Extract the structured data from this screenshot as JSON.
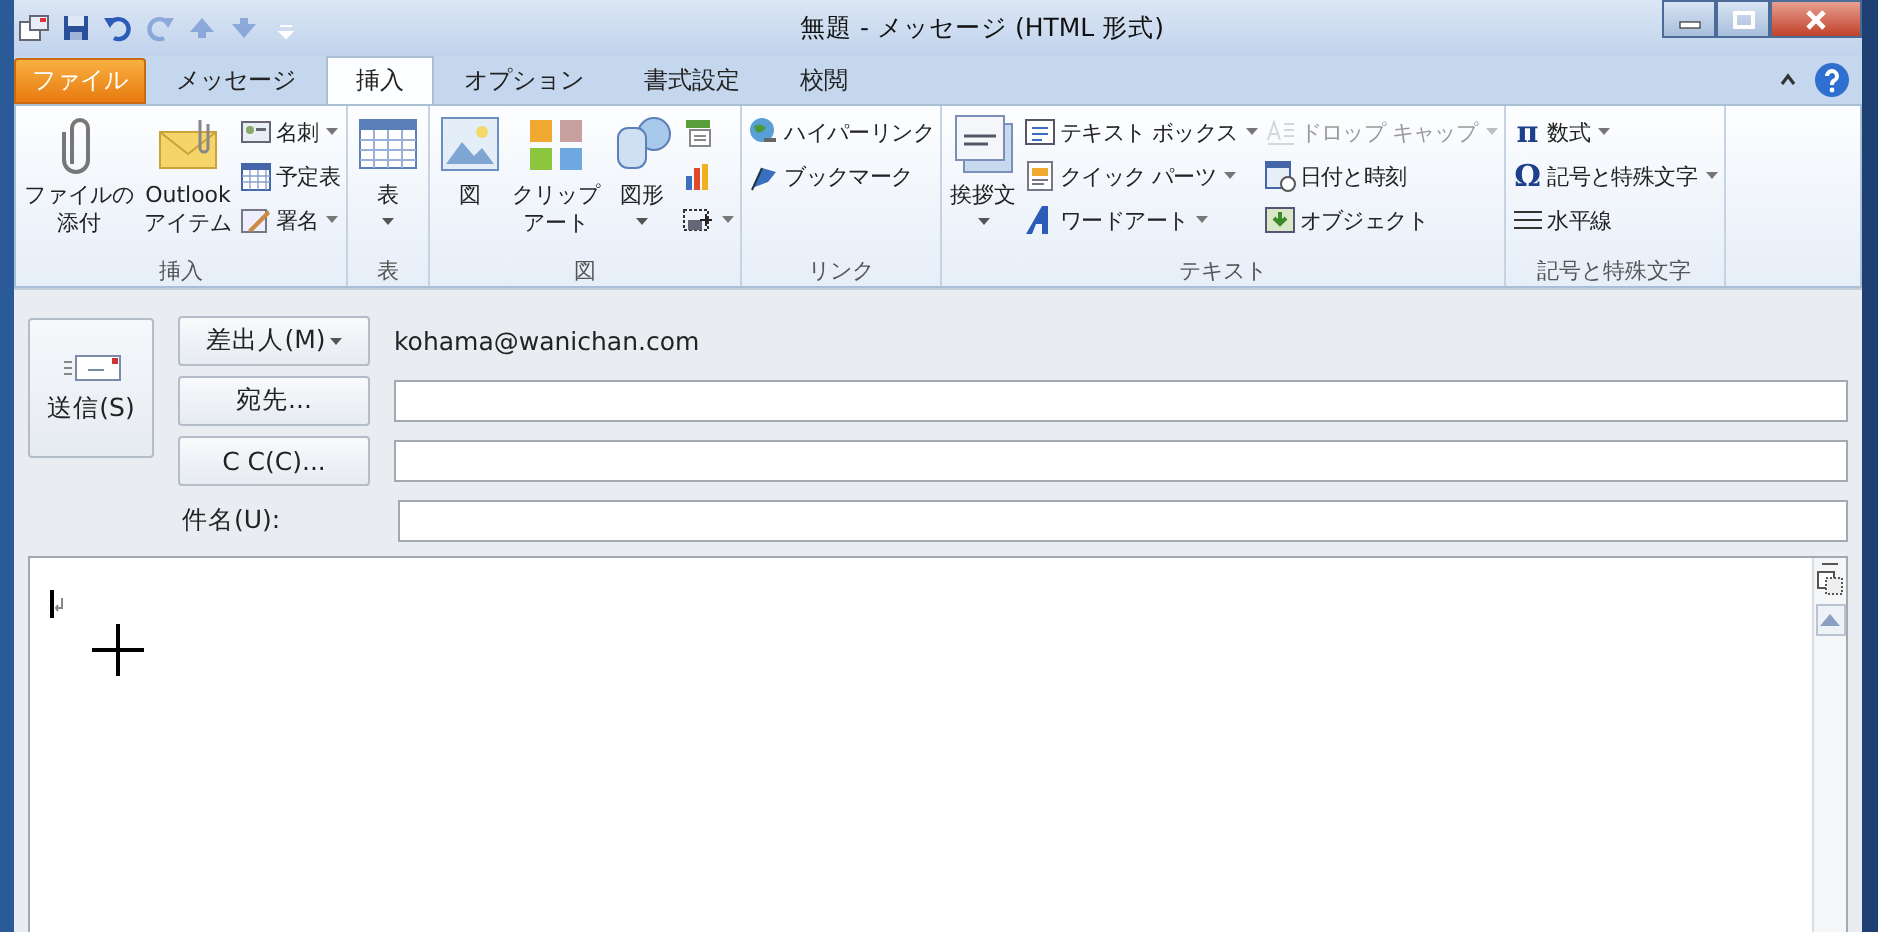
{
  "window": {
    "title": "無題 - メッセージ (HTML 形式)"
  },
  "quick_access": [
    {
      "kind": "save",
      "disabled": false
    },
    {
      "kind": "undo",
      "disabled": false
    },
    {
      "kind": "redo",
      "disabled": true
    },
    {
      "kind": "up",
      "disabled": true
    },
    {
      "kind": "down",
      "disabled": true
    }
  ],
  "tabs": [
    {
      "label": "ファイル",
      "kind": "file",
      "selected": false
    },
    {
      "label": "メッセージ",
      "kind": "tab",
      "selected": false
    },
    {
      "label": "挿入",
      "kind": "tab",
      "selected": true
    },
    {
      "label": "オプション",
      "kind": "tab",
      "selected": false
    },
    {
      "label": "書式設定",
      "kind": "tab",
      "selected": false
    },
    {
      "label": "校閲",
      "kind": "tab",
      "selected": false
    }
  ],
  "ribbon_groups": [
    {
      "label": "挿入",
      "controls": [
        {
          "kind": "large",
          "lines": [
            "ファイルの",
            "添付"
          ],
          "dropdown": false
        },
        {
          "kind": "large",
          "lines": [
            "Outlook",
            "アイテム"
          ],
          "dropdown": false
        },
        {
          "kind": "column",
          "items": [
            {
              "label": "名刺",
              "dropdown": true,
              "disabled": false
            },
            {
              "label": "予定表",
              "dropdown": false,
              "disabled": false
            },
            {
              "label": "署名",
              "dropdown": true,
              "disabled": false
            }
          ]
        }
      ]
    },
    {
      "label": "表",
      "controls": [
        {
          "kind": "large",
          "lines": [
            "表"
          ],
          "dropdown": true
        }
      ]
    },
    {
      "label": "図",
      "controls": [
        {
          "kind": "large",
          "lines": [
            "図"
          ],
          "dropdown": false
        },
        {
          "kind": "large",
          "lines": [
            "クリップ",
            "アート"
          ],
          "dropdown": false
        },
        {
          "kind": "large",
          "lines": [
            "図形"
          ],
          "dropdown": true
        },
        {
          "kind": "column",
          "items": [
            {
              "dropdown": false,
              "disabled": false
            },
            {
              "dropdown": false,
              "disabled": false
            },
            {
              "dropdown": true,
              "disabled": false
            }
          ]
        }
      ]
    },
    {
      "label": "リンク",
      "controls": [
        {
          "kind": "column",
          "items": [
            {
              "label": "ハイパーリンク",
              "dropdown": false,
              "disabled": false
            },
            {
              "label": "ブックマーク",
              "dropdown": false,
              "disabled": false
            }
          ]
        }
      ]
    },
    {
      "label": "テキスト",
      "controls": [
        {
          "kind": "large",
          "lines": [
            "挨拶文"
          ],
          "dropdown": true
        },
        {
          "kind": "column",
          "items": [
            {
              "label": "テキスト ボックス",
              "dropdown": true,
              "disabled": false
            },
            {
              "label": "クイック パーツ",
              "dropdown": true,
              "disabled": false
            },
            {
              "label": "ワードアート",
              "dropdown": true,
              "disabled": false
            }
          ]
        },
        {
          "kind": "column",
          "items": [
            {
              "label": "ドロップ キャップ",
              "dropdown": true,
              "disabled": true
            },
            {
              "label": "日付と時刻",
              "dropdown": false,
              "disabled": false
            },
            {
              "label": "オブジェクト",
              "dropdown": false,
              "disabled": false
            }
          ]
        }
      ]
    },
    {
      "label": "記号と特殊文字",
      "controls": [
        {
          "kind": "column",
          "items": [
            {
              "glyph": "π",
              "label": "数式",
              "dropdown": true,
              "disabled": false
            },
            {
              "glyph": "Ω",
              "label": "記号と特殊文字",
              "dropdown": true,
              "disabled": false
            },
            {
              "label": "水平線",
              "dropdown": false,
              "disabled": false
            }
          ]
        }
      ]
    }
  ],
  "header": {
    "send_button": "送信(S)",
    "from_button": "差出人(M)",
    "from_value": "kohama@wanichan.com",
    "to_button": "宛先...",
    "cc_button": "C C(C)...",
    "subject_label": "件名(U):"
  }
}
